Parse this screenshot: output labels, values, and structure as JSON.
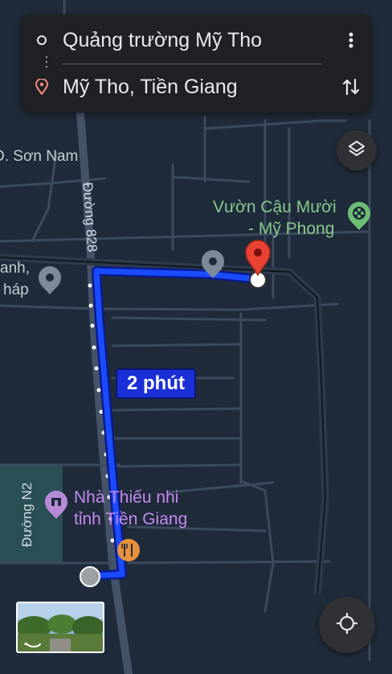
{
  "directions": {
    "origin": "Quảng trường Mỹ Tho",
    "destination": "Mỹ Tho, Tiền Giang"
  },
  "route": {
    "duration_label": "2 phút",
    "route_color": "#1a4cff"
  },
  "places": {
    "park_line1": "Vườn Cậu Mười",
    "park_line2": "- Mỹ Phong",
    "center_line1": "Nhà Thiếu nhi",
    "center_line2": "tỉnh Tiền Giang",
    "partial_left_1": "anh,",
    "partial_left_2": "háp"
  },
  "roads": {
    "duong_828": "Đường 828",
    "duong_n2": "Đường N2",
    "son_nam": "Đ. Sơn Nam"
  },
  "colors": {
    "map_bg": "#1f2b3a",
    "road": "#3b4a5e",
    "destination_pin": "#ea4335"
  },
  "icons": {
    "menu": "more-vert-icon",
    "swap": "swap-icon",
    "layers": "layers-icon",
    "locate": "my-location-icon"
  }
}
